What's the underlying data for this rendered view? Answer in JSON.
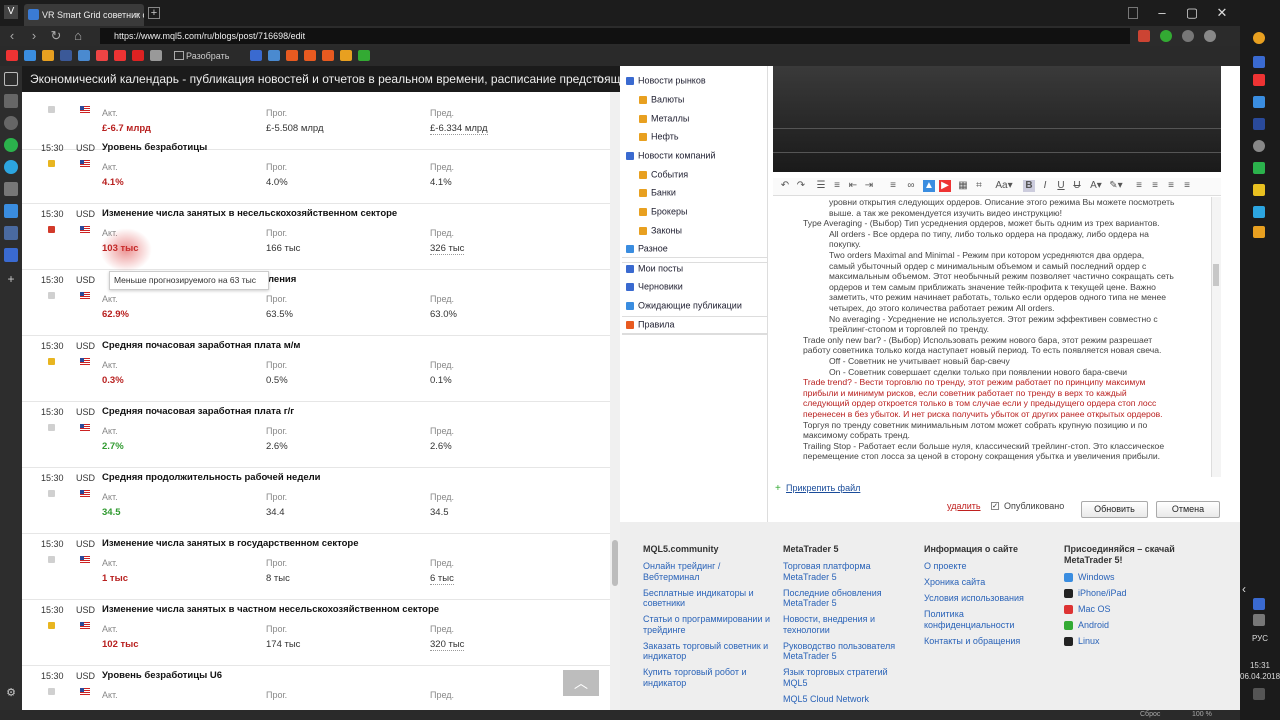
{
  "browser": {
    "tab_title": "VR Smart Grid советник са",
    "url": "https://www.mql5.com/ru/blogs/post/716698/edit",
    "bookmarks_folder": "Разобрать"
  },
  "page_header": "Экономический календарь - публикация новостей и отчетов в реальном времени, расписание предстоящих со...",
  "calendar": {
    "labels": {
      "actual": "Акт.",
      "forecast": "Прог.",
      "previous": "Пред."
    },
    "tooltip": "Меньше прогнозируемого на 63 тыс",
    "rows": [
      {
        "time": "",
        "currency": "",
        "name": "",
        "actual": "£-6.7 млрд",
        "forecast": "£-5.508 млрд",
        "previous": "£-6.334 млрд",
        "color": "red",
        "importance": "none"
      },
      {
        "time": "15:30",
        "currency": "USD",
        "name": "Уровень безработицы",
        "actual": "4.1%",
        "forecast": "4.0%",
        "previous": "4.1%",
        "color": "red",
        "importance": "medium"
      },
      {
        "time": "15:30",
        "currency": "USD",
        "name": "Изменение числа занятых в несельскохозяйственном секторе",
        "actual": "103 тыс",
        "forecast": "166 тыс",
        "previous": "326 тыс",
        "color": "red",
        "importance": "high"
      },
      {
        "time": "15:30",
        "currency": "USD",
        "name": "Уровень участия в рабочей силе",
        "name_visible": "ления",
        "actual": "62.9%",
        "forecast": "63.5%",
        "previous": "63.0%",
        "color": "red",
        "importance": "none"
      },
      {
        "time": "15:30",
        "currency": "USD",
        "name": "Средняя почасовая заработная плата м/м",
        "actual": "0.3%",
        "forecast": "0.5%",
        "previous": "0.1%",
        "color": "red",
        "importance": "medium"
      },
      {
        "time": "15:30",
        "currency": "USD",
        "name": "Средняя почасовая заработная плата г/г",
        "actual": "2.7%",
        "forecast": "2.6%",
        "previous": "2.6%",
        "color": "green",
        "importance": "none"
      },
      {
        "time": "15:30",
        "currency": "USD",
        "name": "Средняя продолжительность рабочей недели",
        "actual": "34.5",
        "forecast": "34.4",
        "previous": "34.5",
        "color": "green",
        "importance": "none"
      },
      {
        "time": "15:30",
        "currency": "USD",
        "name": "Изменение числа занятых в государственном секторе",
        "actual": "1 тыс",
        "forecast": "8 тыс",
        "previous": "6 тыс",
        "color": "red",
        "importance": "none"
      },
      {
        "time": "15:30",
        "currency": "USD",
        "name": "Изменение числа занятых в частном несельскохозяйственном секторе",
        "actual": "102 тыс",
        "forecast": "174 тыс",
        "previous": "320 тыс",
        "color": "red",
        "importance": "medium"
      },
      {
        "time": "15:30",
        "currency": "USD",
        "name": "Уровень безработицы U6",
        "actual": "",
        "forecast": "",
        "previous": "",
        "color": "red",
        "importance": "none"
      }
    ]
  },
  "categories": [
    {
      "label": "Новости рынков",
      "level": 0
    },
    {
      "label": "Валюты",
      "level": 1
    },
    {
      "label": "Металлы",
      "level": 1
    },
    {
      "label": "Нефть",
      "level": 1
    },
    {
      "label": "Новости компаний",
      "level": 0
    },
    {
      "label": "События",
      "level": 1
    },
    {
      "label": "Банки",
      "level": 1
    },
    {
      "label": "Брокеры",
      "level": 1
    },
    {
      "label": "Законы",
      "level": 1
    },
    {
      "label": "Разное",
      "level": 0
    },
    {
      "label": "Мои посты",
      "level": 0
    },
    {
      "label": "Черновики",
      "level": 0
    },
    {
      "label": "Ожидающие публикации",
      "level": 0
    },
    {
      "label": "Правила",
      "level": 0
    }
  ],
  "editor": {
    "lines": [
      {
        "t": "уровни открытия следующих ордеров. Описание этого режима Вы можете посмотреть",
        "i": 56
      },
      {
        "t": "выше. а так же рекомендуется изучить видео инструкцию!",
        "i": 56
      },
      {
        "t": "Type Averaging - (Выбор) Тип усреднения ордеров, может быть одним из трех вариантов.",
        "i": 30
      },
      {
        "t": "All orders - Все ордера по типу, либо только ордера на продажу, либо ордера на",
        "i": 56
      },
      {
        "t": "покупку.",
        "i": 56
      },
      {
        "t": "Two orders Maximal and Minimal - Режим при котором усредняются два ордера,",
        "i": 56
      },
      {
        "t": "самый убыточный ордер с минимальным объемом и самый последний ордер с",
        "i": 56
      },
      {
        "t": "максимальным объемом. Этот необычный режим позволяет частично сокращать сеть",
        "i": 56
      },
      {
        "t": "ордеров и тем самым приближать значение тейк-профита к текущей цене. Важно",
        "i": 56
      },
      {
        "t": "заметить, что режим начинает работать, только если ордеров одного типа не менее",
        "i": 56
      },
      {
        "t": "четырех, до этого количества работает режим All orders.",
        "i": 56
      },
      {
        "t": "No averaging - Усреднение не используется. Этот режим эффективен совместно с",
        "i": 56
      },
      {
        "t": "трейлинг-стопом и торговлей по тренду.",
        "i": 56
      },
      {
        "t": "Trade only new bar? - (Выбор) Использовать режим нового бара, этот режим разрешает",
        "i": 30
      },
      {
        "t": "работу советника только когда наступает новый период. То есть появляется новая свеча.",
        "i": 30
      },
      {
        "t": "Off - Советник не учитывает новый бар-свечу",
        "i": 56
      },
      {
        "t": "On - Советник совершает сделки только при появлении нового бара-свечи",
        "i": 56
      },
      {
        "t": "Trade trend? - Вести торговлю по тренду, этот режим работает по принципу максимум",
        "i": 30,
        "c": "red"
      },
      {
        "t": "прибыли и минимум рисков, если советник работает по тренду в верх то каждый",
        "i": 30,
        "c": "red"
      },
      {
        "t": "следующий ордер откроется только в том случае если у предыдущего ордера стоп лосс",
        "i": 30,
        "c": "red"
      },
      {
        "t": "перенесен в без убыток. И нет риска получить убыток от других ранее открытых ордеров.",
        "i": 30,
        "c": "red"
      },
      {
        "t": "Торгуя по тренду советник минимальным лотом может собрать крупную позицию и по",
        "i": 30
      },
      {
        "t": "максимому собрать тренд.",
        "i": 30
      },
      {
        "t": "Trailing Stop - Работает если больше нуля, классический трейлинг-стоп. Это классическое",
        "i": 30
      },
      {
        "t": "перемещение стоп лосса за ценой в сторону сокращения убытка и увеличения прибыли.",
        "i": 30
      }
    ]
  },
  "form": {
    "attach": "Прикрепить файл",
    "delete": "удалить",
    "published": "Опубликовано",
    "update": "Обновить",
    "cancel": "Отмена"
  },
  "footer": {
    "columns": [
      {
        "title": "MQL5.community",
        "links": [
          "Онлайн трейдинг / Вебтерминал",
          "Бесплатные индикаторы и советники",
          "Статьи о программировании и трейдинге",
          "Заказать торговый советник и индикатор",
          "Купить торговый робот и индикатор"
        ]
      },
      {
        "title": "MetaTrader 5",
        "links": [
          "Торговая платформа MetaTrader 5",
          "Последние обновления MetaTrader 5",
          "Новости, внедрения и технологии",
          "Руководство пользователя MetaTrader 5",
          "Язык торговых стратегий MQL5",
          "MQL5 Cloud Network"
        ]
      },
      {
        "title": "Информация о сайте",
        "links": [
          "О проекте",
          "Хроника сайта",
          "Условия использования",
          "Политика конфиденциальности",
          "Контакты и обращения"
        ]
      },
      {
        "title": "Присоединяйся – скачай MetaTrader 5!",
        "links": [
          "Windows",
          "iPhone/iPad",
          "Mac OS",
          "Android",
          "Linux"
        ]
      }
    ]
  },
  "system": {
    "lang": "РУС",
    "time": "15:31",
    "date": "06.04.2018",
    "zoom": "100 %",
    "reset": "Сброс"
  },
  "colors": {
    "red": "#b8201f",
    "green": "#2f9a2f",
    "link": "#2a63b8",
    "importance_high": "#d23a2a",
    "importance_medium": "#e8b520",
    "importance_none": "#d0d0d0"
  }
}
